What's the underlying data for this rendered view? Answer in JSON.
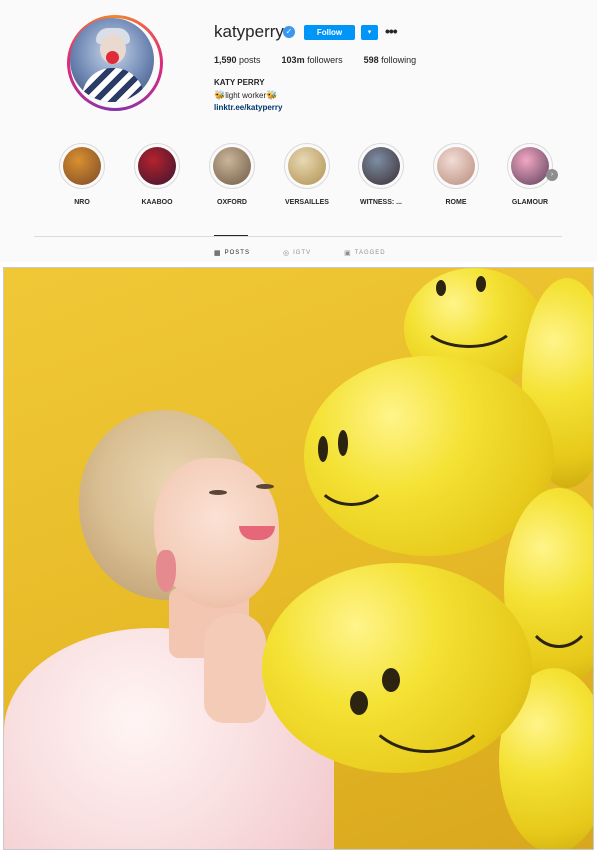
{
  "profile": {
    "username": "katyperry",
    "follow_label": "Follow",
    "dropdown_icon": "▾",
    "more_icon": "•••",
    "verified_icon": "✓",
    "stats": {
      "posts_count": "1,590",
      "posts_label": " posts",
      "followers_count": "103m",
      "followers_label": " followers",
      "following_count": "598",
      "following_label": " following"
    },
    "full_name": "KATY PERRY",
    "bio_text": "light worker",
    "bio_emoji": "🐝",
    "link": "linktr.ee/katyperry"
  },
  "highlights": [
    {
      "label": "NRO",
      "color_a": "#d9902e",
      "color_b": "#7a4a2a"
    },
    {
      "label": "KAABOO",
      "color_a": "#b4232d",
      "color_b": "#3b1430"
    },
    {
      "label": "OXFORD",
      "color_a": "#c9b69a",
      "color_b": "#6e5a45"
    },
    {
      "label": "VERSAILLES",
      "color_a": "#e7d9b3",
      "color_b": "#b08f4e"
    },
    {
      "label": "WITNESS: ...",
      "color_a": "#7d8ea3",
      "color_b": "#3a2d33"
    },
    {
      "label": "ROME",
      "color_a": "#f1ddd6",
      "color_b": "#b98a7a"
    },
    {
      "label": "GLAMOUR",
      "color_a": "#f2a7c3",
      "color_b": "#5a3f5a"
    }
  ],
  "highlights_next_icon": "›",
  "tabs": [
    {
      "label": "POSTS",
      "icon": "▦",
      "active": true
    },
    {
      "label": "IGTV",
      "icon": "◎",
      "active": false
    },
    {
      "label": "TAGGED",
      "icon": "▣",
      "active": false
    }
  ],
  "colors": {
    "accent": "#0095f6",
    "link": "#00376b",
    "photo_background": "#e9bd2a"
  }
}
